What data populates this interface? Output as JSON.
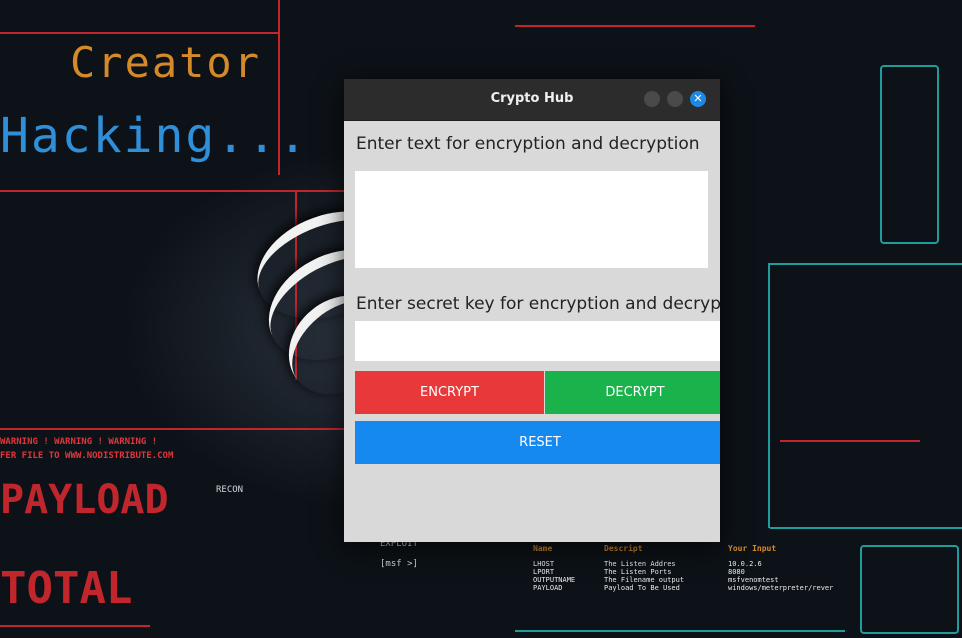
{
  "window": {
    "title": "Crypto Hub",
    "controls": {
      "minimize_icon": "circle-minimize-icon",
      "maximize_icon": "circle-maximize-icon",
      "close_glyph": "✕"
    }
  },
  "form": {
    "text_label": "Enter text for encryption and decryption",
    "text_value": "",
    "key_label": "Enter secret key for encryption and decryption",
    "key_value": "",
    "encrypt_label": "ENCRYPT",
    "decrypt_label": "DECRYPT",
    "reset_label": "RESET"
  },
  "wallpaper": {
    "creator": "Creator",
    "hacking": "Hacking...",
    "warning1": "WARNING ! WARNING ! WARNING !",
    "warning2": "FER FILE TO WWW.NODISTRIBUTE.COM",
    "recon": "RECON",
    "exploit": "EXPLOIT",
    "msf": "[msf >]",
    "table_name": "Name",
    "table_descript": "Descript",
    "table_input": "Your Input",
    "lhost": "LHOST",
    "lport": "LPORT",
    "outputname": "OUTPUTNAME",
    "payload": "PAYLOAD",
    "d1": "The Listen Addres",
    "d2": "The Listen Ports",
    "d3": "The Filename output",
    "d4": "Payload To Be Used",
    "v1": "10.0.2.6",
    "v2": "8080",
    "v3": "msfvenomtest",
    "v4": "windows/meterpreter/rever",
    "payload_big": "PAYLOAD",
    "total_big": "TOTAL",
    "colors": {
      "red": "#c0262c",
      "teal": "#1f9d9d",
      "orange": "#d58a2a",
      "blue": "#2f8fd8"
    }
  }
}
